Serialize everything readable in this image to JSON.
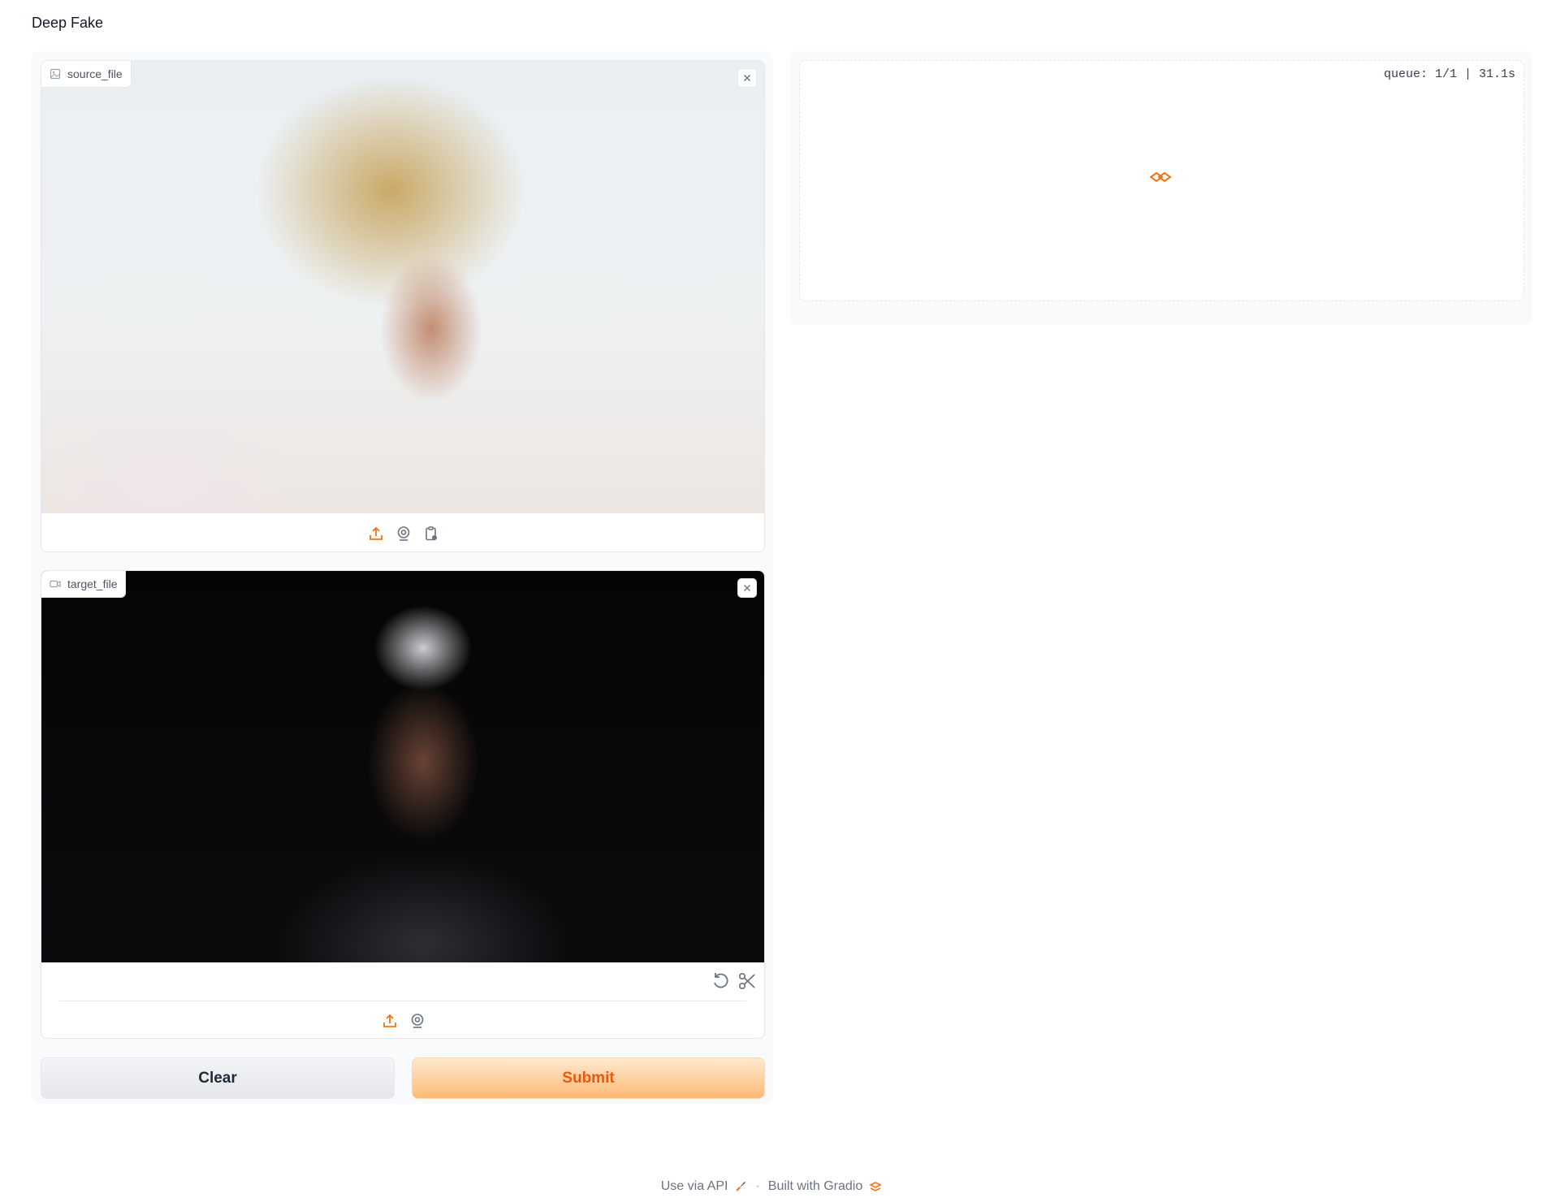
{
  "app": {
    "title": "Deep Fake"
  },
  "source": {
    "label": "source_file",
    "icon": "image-icon"
  },
  "target": {
    "label": "target_file",
    "icon": "video-icon"
  },
  "buttons": {
    "clear": "Clear",
    "submit": "Submit"
  },
  "output": {
    "queue_status": "queue: 1/1 | 31.1s"
  },
  "footer": {
    "api": "Use via API",
    "separator": "·",
    "built": "Built with Gradio"
  },
  "colors": {
    "accent": "#f97316",
    "submit_text": "#ea580c",
    "panel_bg": "#f9fafb"
  }
}
